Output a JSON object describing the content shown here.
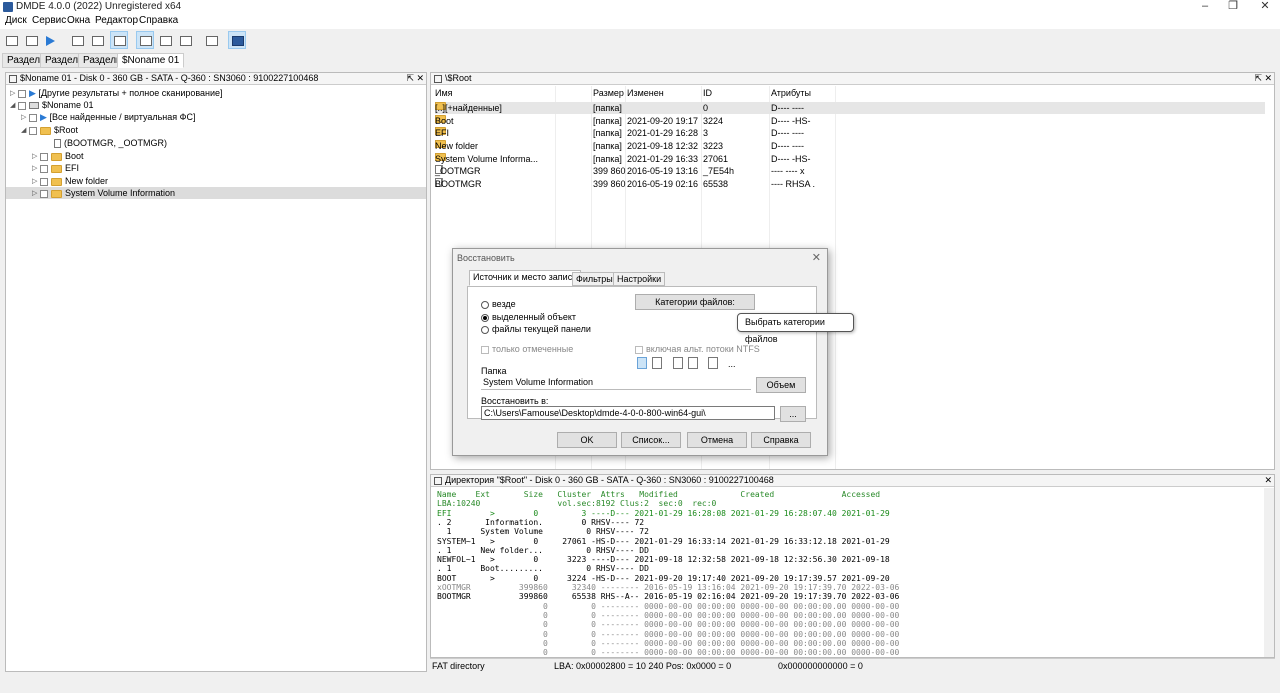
{
  "window": {
    "title": "DMDE 4.0.0 (2022) Unregistered x64"
  },
  "menu": [
    "Диск",
    "Сервис",
    "Окна",
    "Редактор",
    "Справка"
  ],
  "tabs": [
    {
      "label": "Разделы"
    },
    {
      "label": "Разделы"
    },
    {
      "label": "Разделы"
    },
    {
      "label": "$Noname 01"
    }
  ],
  "left_panel": {
    "header": "$Noname 01 - Disk 0 - 360 GB - SATA - Q-360 : SN3060 : 9100227100468",
    "tree": [
      {
        "label": "[Другие результаты + полное сканирование]"
      },
      {
        "label": "$Noname 01"
      },
      {
        "label": "[Все найденные / виртуальная ФС]"
      },
      {
        "label": "$Root"
      },
      {
        "label": "(BOOTMGR, _OOTMGR)"
      },
      {
        "label": "Boot"
      },
      {
        "label": "EFI"
      },
      {
        "label": "New folder"
      },
      {
        "label": "System Volume Information"
      }
    ]
  },
  "right_panel": {
    "header": "\\$Root",
    "columns": [
      "Имя",
      "Размер",
      "Изменен",
      "ID",
      "Атрибуты"
    ],
    "rows": [
      {
        "name": "[..][+найденные]",
        "size": "[папка]",
        "modified": "",
        "id": "0",
        "attrs": "D---- ----"
      },
      {
        "name": "Boot",
        "size": "[папка]",
        "modified": "2021-09-20 19:17",
        "id": "3224",
        "attrs": "D---- -HS-"
      },
      {
        "name": "EFI",
        "size": "[папка]",
        "modified": "2021-01-29 16:28",
        "id": "3",
        "attrs": "D---- ----"
      },
      {
        "name": "New folder",
        "size": "[папка]",
        "modified": "2021-09-18 12:32",
        "id": "3223",
        "attrs": "D---- ----"
      },
      {
        "name": "System Volume Informa...",
        "size": "[папка]",
        "modified": "2021-01-29 16:33",
        "id": "27061",
        "attrs": "D---- -HS-"
      },
      {
        "name": "_OOTMGR",
        "size": "399 860",
        "modified": "2016-05-19 13:16",
        "id": "_7E54h",
        "attrs": "---- ----  x"
      },
      {
        "name": "BOOTMGR",
        "size": "399 860",
        "modified": "2016-05-19 02:16",
        "id": "65538",
        "attrs": "---- RHSA  ."
      }
    ]
  },
  "dialog": {
    "title": "Восстановить",
    "tabs": [
      "Источник и место записи",
      "Фильтры",
      "Настройки"
    ],
    "radio_all": "везде",
    "radio_selected": "выделенный объект",
    "radio_panel": "файлы текущей панели",
    "only_marked": "только отмеченные",
    "categories_button": "Категории файлов:",
    "include_ntfs": "включая альт. потоки NTFS",
    "folder_label": "Папка",
    "folder_value": "System Volume Information",
    "object_button": "Объем",
    "restore_to_label": "Восстановить в:",
    "restore_to_value": "C:\\Users\\Famouse\\Desktop\\dmde-4-0-0-800-win64-gui\\",
    "browse_button": "...",
    "more_button": "...",
    "ok": "OK",
    "list": "Список...",
    "cancel": "Отмена",
    "help": "Справка"
  },
  "tooltip": "Выбрать категории файлов",
  "bottom_panel": {
    "header": "Директория \"$Root\" - Disk 0 - 360 GB - SATA - Q-360 : SN3060 : 9100227100468",
    "lines": [
      {
        "text": "Name    Ext       Size   Cluster  Attrs   Modified             Created              Accessed",
        "style": "c-h"
      },
      {
        "text": "LBA:10240                vol.sec:8192 Clus:2  sec:0  rec:0",
        "style": "c-h"
      },
      {
        "text": "EFI        >        0         3 ----D--- 2021-01-29 16:28:08 2021-01-29 16:28:07.40 2021-01-29",
        "style": "c-blue"
      },
      {
        "text": ". 2       Information.        0 RHSV---- 72",
        "style": "c-n"
      },
      {
        "text": "  1      System Volume         0 RHSV---- 72",
        "style": "c-n"
      },
      {
        "text": "SYSTEM~1   >        0     27061 -HS-D--- 2021-01-29 16:33:14 2021-01-29 16:33:12.18 2021-01-29",
        "style": "c-n"
      },
      {
        "text": ". 1      New folder...         0 RHSV---- DD",
        "style": "c-n"
      },
      {
        "text": "NEWFOL~1   >        0      3223 ----D--- 2021-09-18 12:32:58 2021-09-18 12:32:56.30 2021-09-18",
        "style": "c-n"
      },
      {
        "text": ". 1      Boot.........         0 RHSV---- DD",
        "style": "c-n"
      },
      {
        "text": "BOOT       >        0      3224 -HS-D--- 2021-09-20 19:17:40 2021-09-20 19:17:39.57 2021-09-20",
        "style": "c-n"
      },
      {
        "text": "xOOTMGR          399860     32340 -------- 2016-05-19 13:16:04 2021-09-20 19:17:39.70 2022-03-06",
        "style": "c-grey"
      },
      {
        "text": "BOOTMGR          399860     65538 RHS--A-- 2016-05-19 02:16:04 2021-09-20 19:17:39.70 2022-03-06",
        "style": "c-n"
      },
      {
        "text": "                      0         0 -------- 0000-00-00 00:00:00 0000-00-00 00:00:00.00 0000-00-00",
        "style": "c-grey"
      },
      {
        "text": "                      0         0 -------- 0000-00-00 00:00:00 0000-00-00 00:00:00.00 0000-00-00",
        "style": "c-grey"
      },
      {
        "text": "                      0         0 -------- 0000-00-00 00:00:00 0000-00-00 00:00:00.00 0000-00-00",
        "style": "c-grey"
      },
      {
        "text": "                      0         0 -------- 0000-00-00 00:00:00 0000-00-00 00:00:00.00 0000-00-00",
        "style": "c-grey"
      },
      {
        "text": "                      0         0 -------- 0000-00-00 00:00:00 0000-00-00 00:00:00.00 0000-00-00",
        "style": "c-grey"
      },
      {
        "text": "                      0         0 -------- 0000-00-00 00:00:00 0000-00-00 00:00:00.00 0000-00-00",
        "style": "c-grey"
      }
    ]
  },
  "status": {
    "type": "FAT directory",
    "lba": "LBA: 0x00002800 = 10 240  Pos: 0x0000 = 0",
    "offset": "0x000000000000 = 0"
  },
  "colors": {
    "accent": "#2b5a9c",
    "console_green": "#2a8a2a"
  }
}
